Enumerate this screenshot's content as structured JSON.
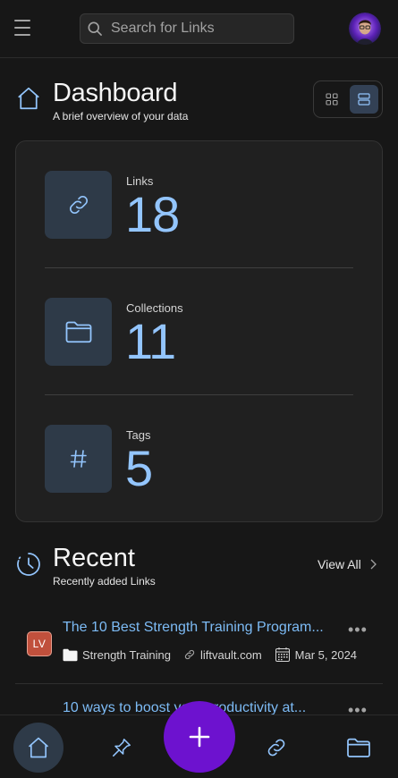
{
  "topbar": {
    "search": {
      "placeholder": "Search for Links",
      "value": ""
    }
  },
  "dashboard": {
    "title": "Dashboard",
    "subtitle": "A brief overview of your data"
  },
  "stats": [
    {
      "label": "Links",
      "value": "18",
      "icon": "link-icon"
    },
    {
      "label": "Collections",
      "value": "11",
      "icon": "folder-icon"
    },
    {
      "label": "Tags",
      "value": "5",
      "icon": "hash-icon"
    }
  ],
  "recent": {
    "title": "Recent",
    "subtitle": "Recently added Links",
    "view_all": "View All",
    "links": [
      {
        "badge": "LV",
        "title": "The 10 Best Strength Training Program...",
        "collection": "Strength Training",
        "domain": "liftvault.com",
        "date": "Mar 5, 2024"
      },
      {
        "title": "10 ways to boost your productivity at..."
      }
    ]
  },
  "colors": {
    "accent": "#93c5fd",
    "link": "#7dbbf5",
    "fab": "#6d12cf",
    "icon_tile": "#2e3a48",
    "background": "#171717"
  }
}
